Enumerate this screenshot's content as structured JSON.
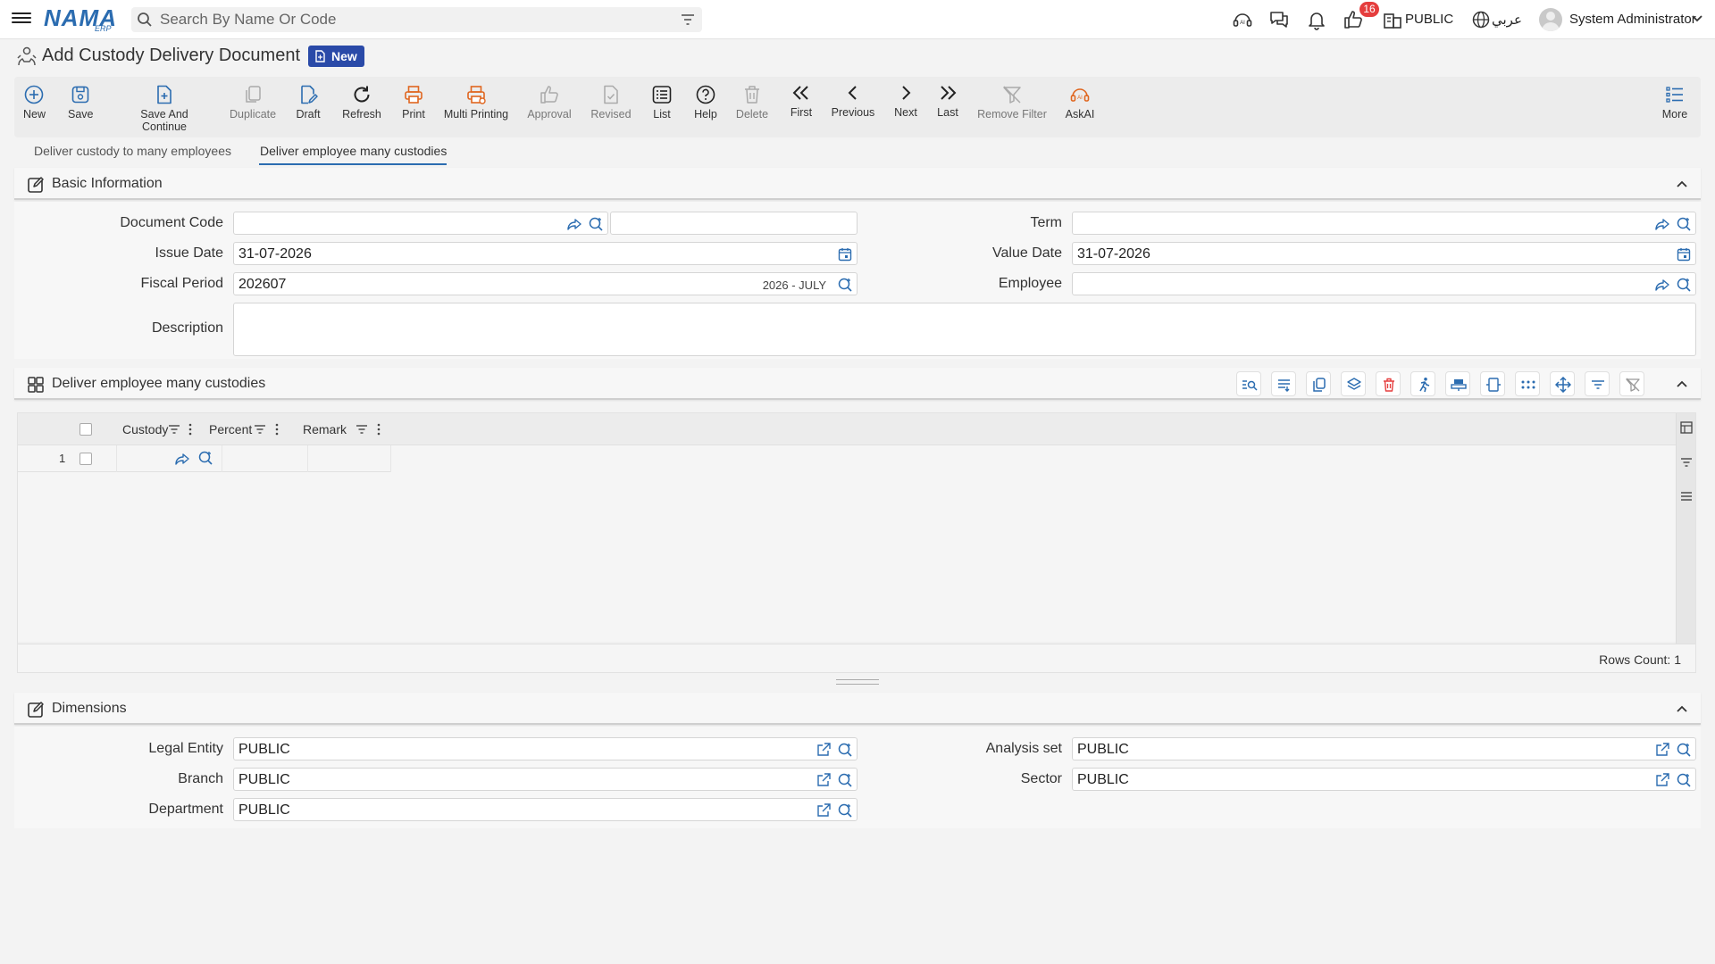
{
  "app": {
    "logo_main": "NAMA",
    "logo_sub": "ERP",
    "search_placeholder": "Search By Name Or Code",
    "notification_count": "16",
    "company": "PUBLIC",
    "language": "عربي",
    "user": "System Administrator"
  },
  "page": {
    "title": "Add Custody Delivery Document",
    "status_badge": "New"
  },
  "toolbar": {
    "new": "New",
    "save": "Save",
    "save_continue": "Save And Continue",
    "duplicate": "Duplicate",
    "draft": "Draft",
    "refresh": "Refresh",
    "print": "Print",
    "multi_printing": "Multi Printing",
    "approval": "Approval",
    "revised": "Revised",
    "list": "List",
    "help": "Help",
    "delete": "Delete",
    "first": "First",
    "previous": "Previous",
    "next": "Next",
    "last": "Last",
    "remove_filter": "Remove Filter",
    "ask_ai": "AskAI",
    "more": "More"
  },
  "tabs": [
    {
      "label": "Deliver custody to many employees",
      "active": false
    },
    {
      "label": "Deliver employee many custodies",
      "active": true
    }
  ],
  "basic_info": {
    "title": "Basic Information",
    "labels": {
      "document_code": "Document Code",
      "issue_date": "Issue Date",
      "fiscal_period": "Fiscal Period",
      "description": "Description",
      "term": "Term",
      "value_date": "Value Date",
      "employee": "Employee"
    },
    "values": {
      "document_code": "",
      "document_code_2": "",
      "issue_date": "31-07-2026",
      "fiscal_period": "202607",
      "fiscal_period_hint": "2026 - JULY",
      "description": "",
      "term": "",
      "value_date": "31-07-2026",
      "employee": ""
    }
  },
  "grid_section": {
    "title": "Deliver employee many custodies",
    "columns": [
      "Custody",
      "Percent",
      "Remark"
    ],
    "rows": [
      {
        "index": "1",
        "custody": "",
        "percent": "",
        "remark": ""
      }
    ],
    "rows_count": "Rows Count: 1"
  },
  "dimensions": {
    "title": "Dimensions",
    "labels": {
      "legal_entity": "Legal Entity",
      "branch": "Branch",
      "department": "Department",
      "analysis_set": "Analysis set",
      "sector": "Sector"
    },
    "values": {
      "legal_entity": "PUBLIC",
      "branch": "PUBLIC",
      "department": "PUBLIC",
      "analysis_set": "PUBLIC",
      "sector": "PUBLIC"
    }
  },
  "colors": {
    "primary": "#2b6cb0",
    "print_orange": "#e0661f",
    "delete_red": "#e53e3e",
    "badge_blue": "#2a4aa8"
  }
}
